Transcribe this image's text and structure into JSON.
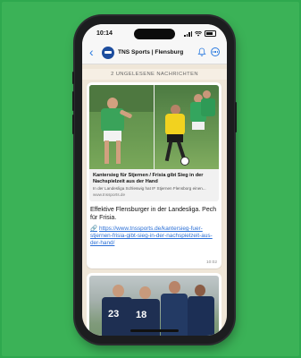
{
  "statusbar": {
    "time": "10:14"
  },
  "header": {
    "back_icon": "chevron-left-icon",
    "channel_name": "TNS Sports | Flensburg",
    "bell_icon": "bell-icon",
    "more_icon": "more-circle-icon"
  },
  "unread_banner": "2 UNGELESENE NACHRICHTEN",
  "message1": {
    "preview": {
      "title": "Kantersieg für Stjernen / Frisia gibt Sieg in der Nachspielzeit aus der Hand",
      "description": "In der Landesliga Schleswig hat IF Stjernen Flensborg einen...",
      "site": "www.tnssports.de"
    },
    "text": "Effektive Flensburger in der Landesliga. Pech für Frisia.",
    "link": "https://www.tnssports.de/kantersieg-fuer-stjernen-frisia-gibt-sieg-in-der-nachspielzeit-aus-der-hand/",
    "link_icon": "link-icon",
    "time": "10:02"
  },
  "message2": {
    "jersey_numbers": [
      "23",
      "18"
    ]
  },
  "colors": {
    "background": "#2ea84e",
    "link": "#2a6fd6",
    "accent": "#2a7ae0",
    "chat_background": "#efe6d8"
  }
}
